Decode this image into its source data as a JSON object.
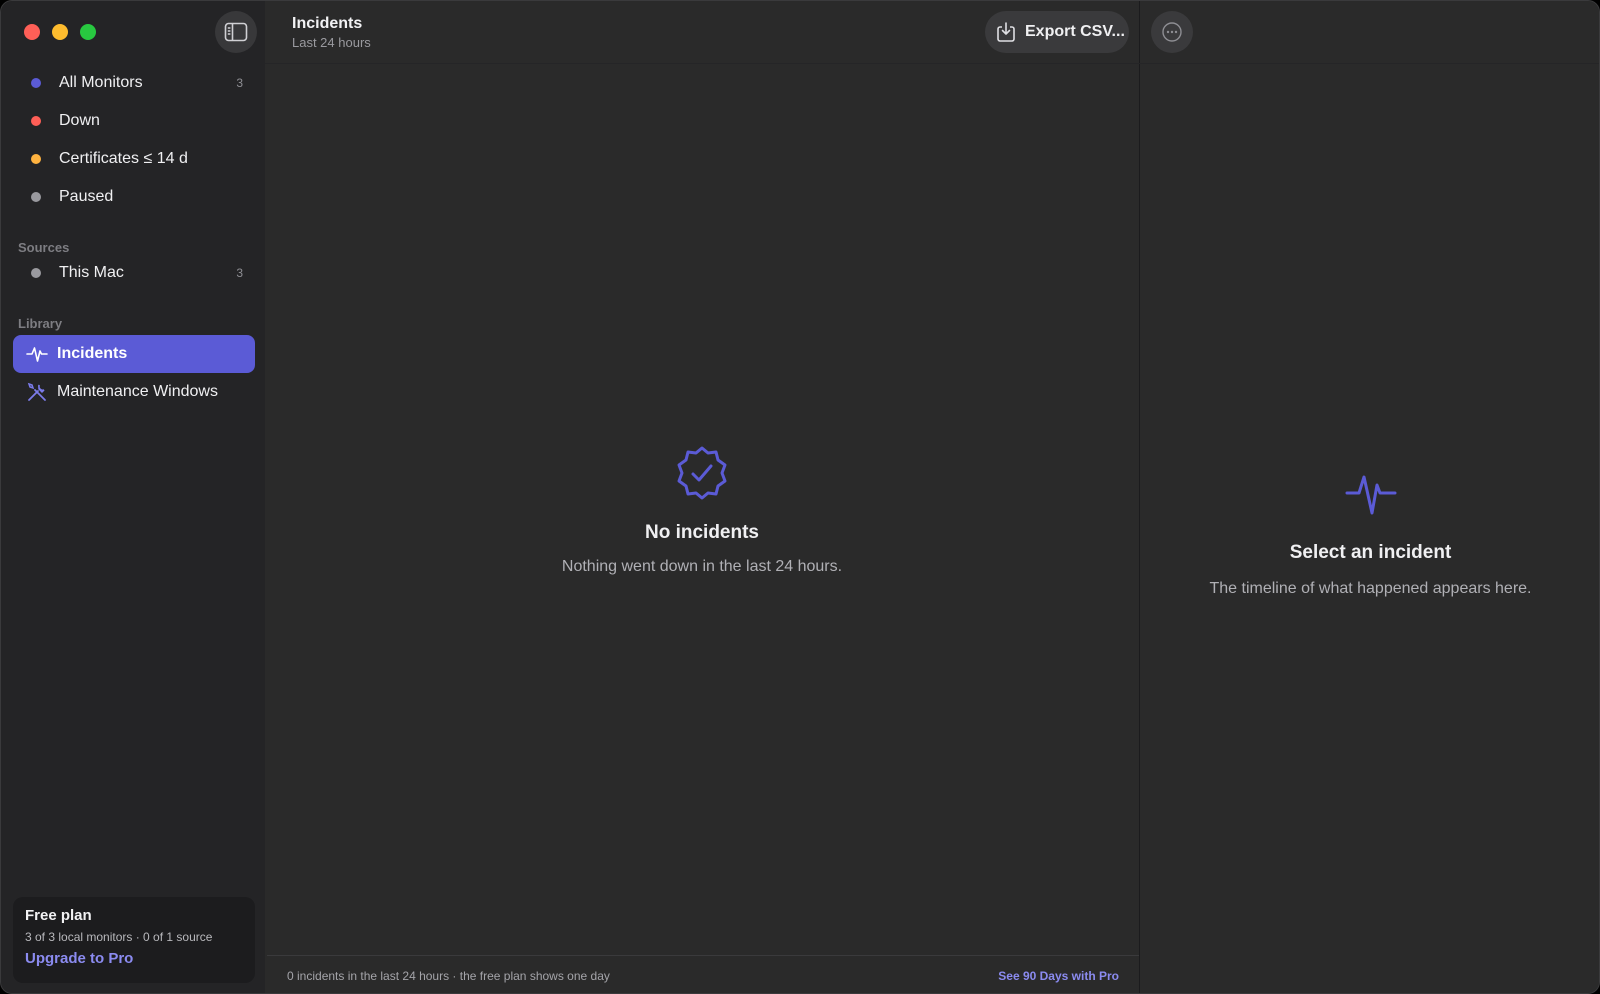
{
  "header": {
    "title": "Incidents",
    "subtitle": "Last 24 hours",
    "export_label": "Export CSV..."
  },
  "sidebar": {
    "items": [
      {
        "label": "All Monitors",
        "count": "3",
        "color": "#5b5bd6"
      },
      {
        "label": "Down",
        "count": "",
        "color": "#ff5f57"
      },
      {
        "label": "Certificates ≤ 14 d",
        "count": "",
        "color": "#ffb340"
      },
      {
        "label": "Paused",
        "count": "",
        "color": "#9a9a9f"
      }
    ],
    "sources_label": "Sources",
    "sources": [
      {
        "label": "This Mac",
        "count": "3",
        "color": "#9a9a9f"
      }
    ],
    "library_label": "Library",
    "library": [
      {
        "label": "Incidents",
        "icon": "pulse-icon",
        "active": true
      },
      {
        "label": "Maintenance Windows",
        "icon": "tools-icon",
        "active": false
      }
    ]
  },
  "plan": {
    "title": "Free plan",
    "detail": "3 of 3 local monitors · 0 of 1 source",
    "upgrade": "Upgrade to Pro"
  },
  "main": {
    "empty_title": "No incidents",
    "empty_subtitle": "Nothing went down in the last 24 hours."
  },
  "footer": {
    "text": "0 incidents in the last 24 hours · the free plan shows one day",
    "link": "See 90 Days with Pro"
  },
  "detail": {
    "empty_title": "Select an incident",
    "empty_subtitle": "The timeline of what happened appears here."
  },
  "colors": {
    "accent": "#5b5bd6",
    "accent_link": "#8b8bf0"
  }
}
